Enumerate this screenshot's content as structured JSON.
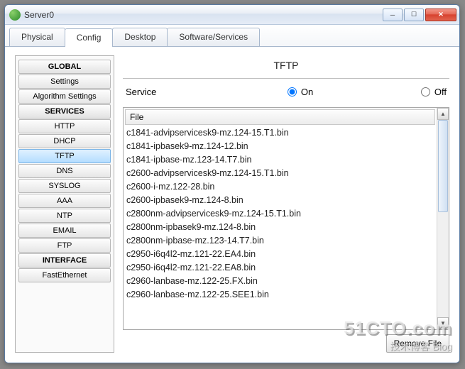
{
  "window": {
    "title": "Server0"
  },
  "tabs": [
    {
      "label": "Physical"
    },
    {
      "label": "Config"
    },
    {
      "label": "Desktop"
    },
    {
      "label": "Software/Services"
    }
  ],
  "active_tab_index": 1,
  "sidebar": {
    "sections": [
      {
        "header": "GLOBAL",
        "items": [
          {
            "label": "Settings"
          },
          {
            "label": "Algorithm Settings"
          }
        ]
      },
      {
        "header": "SERVICES",
        "items": [
          {
            "label": "HTTP"
          },
          {
            "label": "DHCP"
          },
          {
            "label": "TFTP",
            "active": true
          },
          {
            "label": "DNS"
          },
          {
            "label": "SYSLOG"
          },
          {
            "label": "AAA"
          },
          {
            "label": "NTP"
          },
          {
            "label": "EMAIL"
          },
          {
            "label": "FTP"
          }
        ]
      },
      {
        "header": "INTERFACE",
        "items": [
          {
            "label": "FastEthernet"
          }
        ]
      }
    ]
  },
  "page": {
    "title": "TFTP",
    "service_label": "Service",
    "on_label": "On",
    "off_label": "Off",
    "service_state": "on",
    "file_header": "File",
    "remove_label": "Remove File",
    "files": [
      "c1841-advipservicesk9-mz.124-15.T1.bin",
      "c1841-ipbasek9-mz.124-12.bin",
      "c1841-ipbase-mz.123-14.T7.bin",
      "c2600-advipservicesk9-mz.124-15.T1.bin",
      "c2600-i-mz.122-28.bin",
      "c2600-ipbasek9-mz.124-8.bin",
      "c2800nm-advipservicesk9-mz.124-15.T1.bin",
      "c2800nm-ipbasek9-mz.124-8.bin",
      "c2800nm-ipbase-mz.123-14.T7.bin",
      "c2950-i6q4l2-mz.121-22.EA4.bin",
      "c2950-i6q4l2-mz.121-22.EA8.bin",
      "c2960-lanbase-mz.122-25.FX.bin",
      "c2960-lanbase-mz.122-25.SEE1.bin"
    ]
  },
  "watermark": {
    "line1": "51CTO.com",
    "line2": "技术博客  Blog"
  }
}
